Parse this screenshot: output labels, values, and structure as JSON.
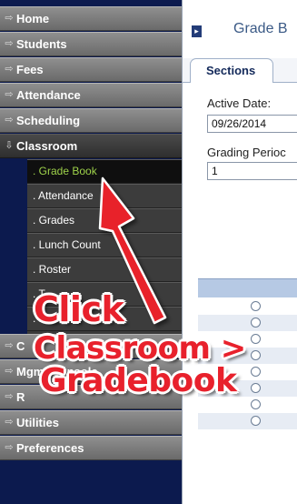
{
  "sidebar": {
    "items": [
      {
        "label": "Home",
        "icon": "arrow-icon"
      },
      {
        "label": "Students",
        "icon": "arrow-icon"
      },
      {
        "label": "Fees",
        "icon": "arrow-icon"
      },
      {
        "label": "Attendance",
        "icon": "arrow-icon"
      },
      {
        "label": "Scheduling",
        "icon": "arrow-icon"
      },
      {
        "label": "Classroom",
        "icon": "arrow-down-icon"
      }
    ],
    "classroom_submenu": [
      {
        "label": ". Grade Book"
      },
      {
        "label": ". Attendance"
      },
      {
        "label": ". Grades"
      },
      {
        "label": ". Lunch Count"
      },
      {
        "label": ". Roster"
      },
      {
        "label": ". T"
      },
      {
        "label": ". R"
      }
    ],
    "items_below": [
      {
        "label": "C"
      },
      {
        "label": "Mgmt Console"
      },
      {
        "label": "R"
      },
      {
        "label": "Utilities"
      },
      {
        "label": "Preferences"
      }
    ]
  },
  "main": {
    "breadcrumb_icon": "▸",
    "title": "Grade B",
    "tab_label": "Sections",
    "active_date_label": "Active Date:",
    "active_date_value": "09/26/2014",
    "grading_period_label": "Grading Perioc",
    "grading_period_value": "1"
  },
  "annotation": {
    "line1": "Click",
    "line2": "Classroom >",
    "line3": "Gradebook",
    "color": "#e8212c"
  },
  "colors": {
    "sidebar_item": "#7d7d7d",
    "selected_item_text": "#9ed24a",
    "title_text": "#3b5a86",
    "grid_header": "#b6c9e4"
  }
}
